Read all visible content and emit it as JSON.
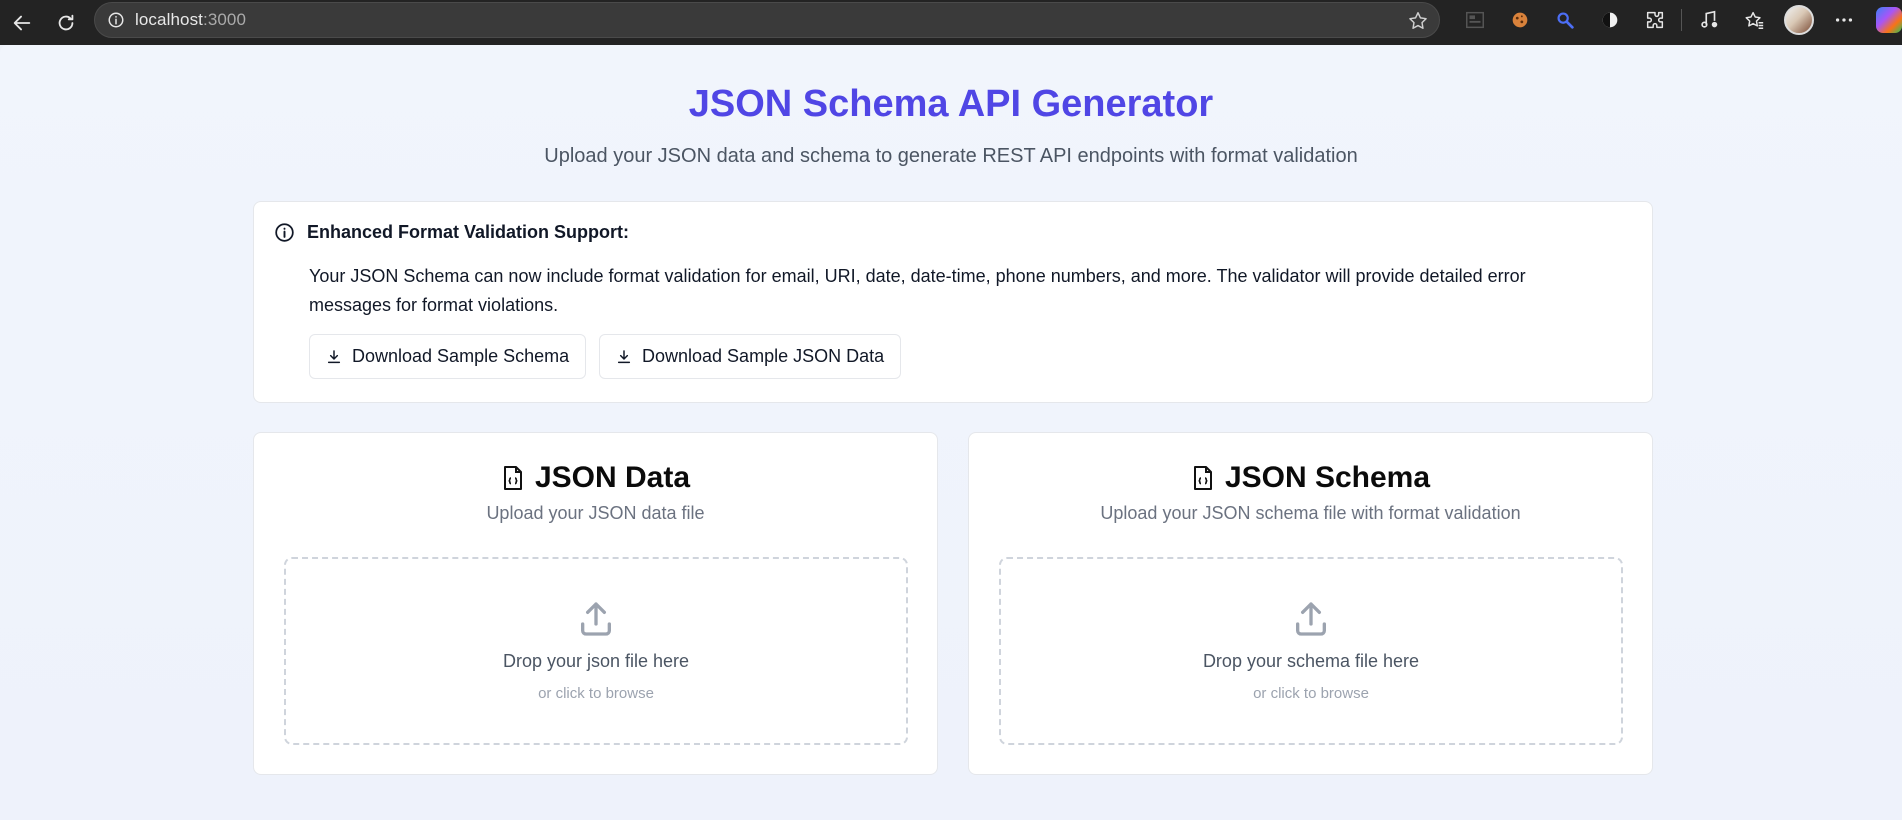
{
  "browser": {
    "url_host": "localhost",
    "url_port": ":3000"
  },
  "header": {
    "title": "JSON Schema API Generator",
    "subtitle": "Upload your JSON data and schema to generate REST API endpoints with format validation"
  },
  "info": {
    "heading": "Enhanced Format Validation Support:",
    "description": "Your JSON Schema can now include format validation for email, URI, date, date-time, phone numbers, and more. The validator will provide detailed error messages for format violations.",
    "btn_schema": "Download Sample Schema",
    "btn_data": "Download Sample JSON Data"
  },
  "cards": {
    "data": {
      "title": "JSON Data",
      "subtitle": "Upload your JSON data file",
      "drop_text": "Drop your json file here",
      "hint": "or click to browse"
    },
    "schema": {
      "title": "JSON Schema",
      "subtitle": "Upload your JSON schema file with format validation",
      "drop_text": "Drop your schema file here",
      "hint": "or click to browse"
    }
  },
  "colors": {
    "accent": "#5046e5",
    "chrome": "#232323"
  }
}
